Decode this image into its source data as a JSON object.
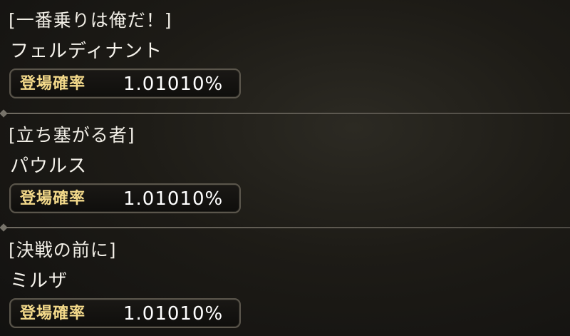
{
  "rate_label": "登場確率",
  "entries": [
    {
      "title": "[一番乗りは俺だ！]",
      "name": "フェルディナント",
      "rate": "1.01010%"
    },
    {
      "title": "[立ち塞がる者]",
      "name": "パウルス",
      "rate": "1.01010%"
    },
    {
      "title": "[決戦の前に]",
      "name": "ミルザ",
      "rate": "1.01010%"
    }
  ]
}
